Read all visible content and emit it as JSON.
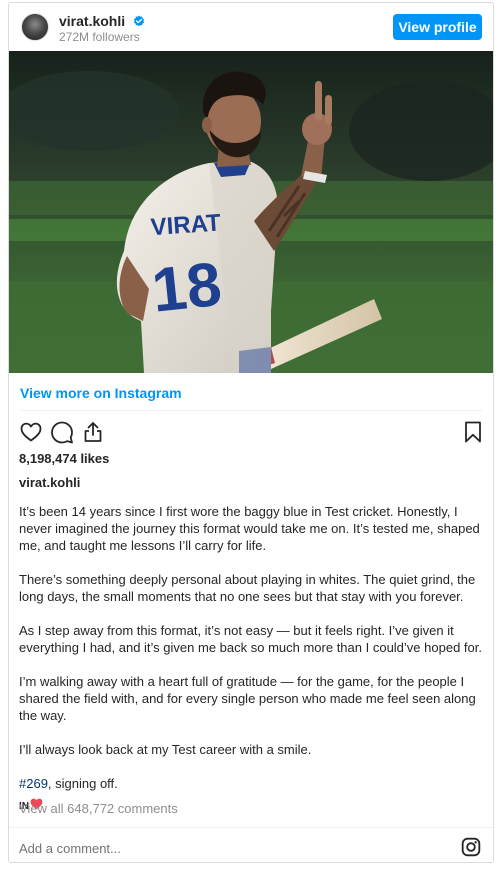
{
  "header": {
    "username": "virat.kohli",
    "followers": "272M followers",
    "view_profile_label": "View profile"
  },
  "post": {
    "view_more_label": "View more on Instagram",
    "likes": "8,198,474 likes",
    "caption_username": "virat.kohli",
    "caption_paragraphs": [
      "It’s been 14 years since I first wore the baggy blue in Test cricket. Honestly, I never imagined the journey this format would take me on. It’s tested me, shaped me, and taught me lessons I’ll carry for life.",
      "There’s something deeply personal about playing in whites. The quiet grind, the long days, the small moments that no one sees but that stay with you forever.",
      "As I step away from this format, it’s not easy — but it feels right. I’ve given it everything I had, and it’s given me back so much more than I could’ve hoped for.",
      "I’m walking away with a heart full of gratitude — for the game, for the people I shared the field with, and for every single person who made me feel seen along the way.",
      "I’ll always look back at my Test career with a smile."
    ],
    "hashtag": "#269",
    "signoff": ", signing off.",
    "flag_text": "IN",
    "view_comments": "View all 648,772 comments",
    "photo_jersey_name": "VIRAT",
    "photo_jersey_number": "18"
  },
  "comment": {
    "placeholder": "Add a comment..."
  },
  "icons": {
    "verified": "verified-badge-icon",
    "like": "heart-outline-icon",
    "comment": "comment-bubble-icon",
    "share": "share-icon",
    "save": "bookmark-icon",
    "emoji_heart": "red-heart-emoji",
    "instagram": "instagram-logo-icon"
  },
  "colors": {
    "accent": "#0095f6",
    "text": "#262626",
    "muted": "#8e8e8e",
    "hashtag": "#00376b",
    "heart": "#ed4956"
  }
}
